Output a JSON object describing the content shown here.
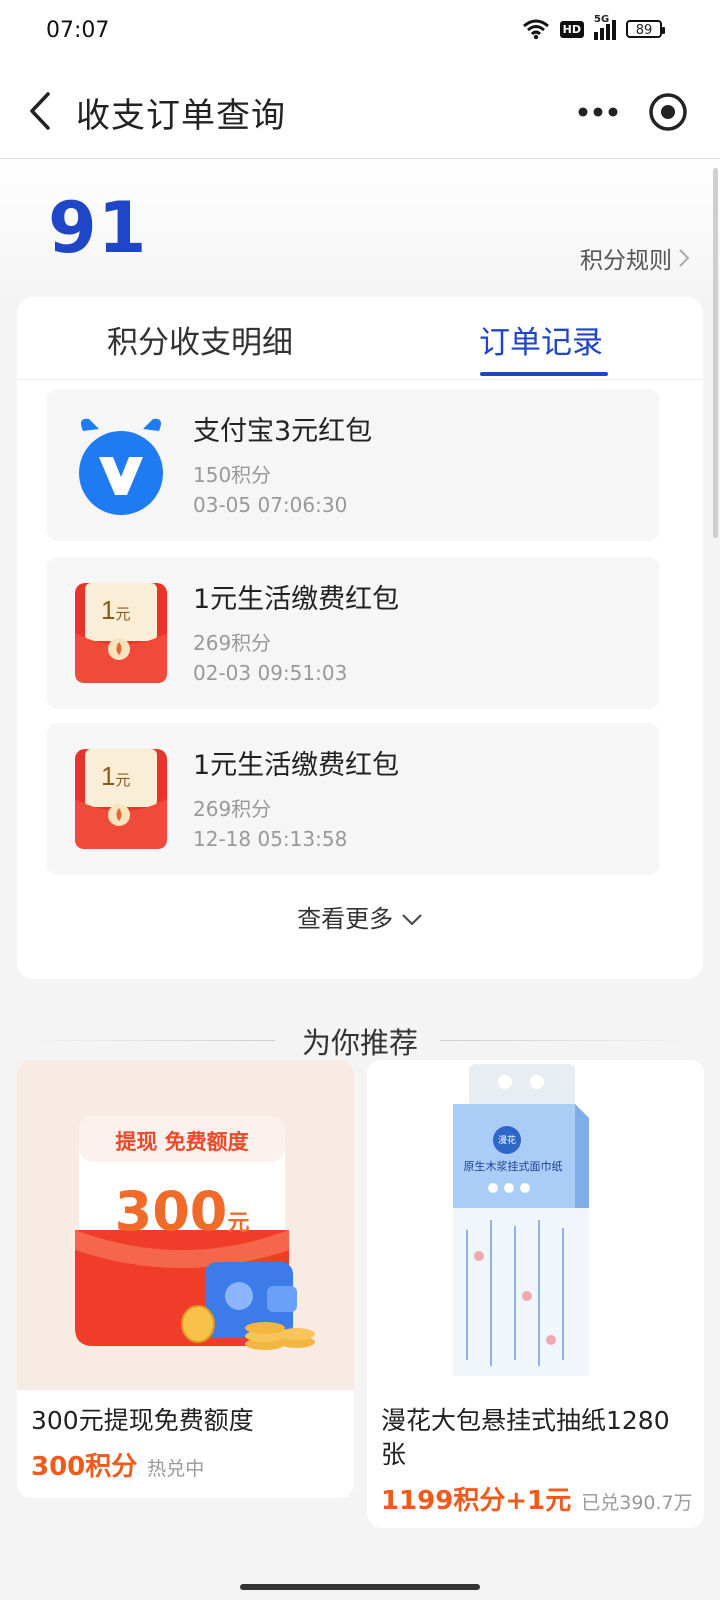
{
  "status": {
    "time": "07:07",
    "network": "5G",
    "hd": "HD",
    "battery": "89"
  },
  "nav": {
    "title": "收支订单查询"
  },
  "summary": {
    "points": "91",
    "rules_label": "积分规则"
  },
  "tabs": [
    {
      "label": "积分收支明细",
      "active": false
    },
    {
      "label": "订单记录",
      "active": true
    }
  ],
  "orders": [
    {
      "name": "支付宝3元红包",
      "points": "150积分",
      "date": "03-05 07:06:30",
      "icon": "alipay-v-icon"
    },
    {
      "name": "1元生活缴费红包",
      "points": "269积分",
      "date": "02-03 09:51:03",
      "icon": "red-envelope-icon",
      "badge": "1",
      "badge_unit": "元"
    },
    {
      "name": "1元生活缴费红包",
      "points": "269积分",
      "date": "12-18 05:13:58",
      "icon": "red-envelope-icon",
      "badge": "1",
      "badge_unit": "元"
    }
  ],
  "see_more": "查看更多",
  "recommend": {
    "title": "为你推荐",
    "products": [
      {
        "name": "300元提现免费额度",
        "price": "300积分",
        "note": "热兑中",
        "image_banner": "提现 免费额度",
        "image_amount": "300",
        "image_unit": "元"
      },
      {
        "name": "漫花大包悬挂式抽纸1280张",
        "price": "1199积分+1元",
        "note": "已兑390.7万",
        "image_brand": "漫花",
        "image_caption": "原生木浆挂式面巾纸"
      }
    ]
  },
  "colors": {
    "accent": "#1f46c7",
    "price": "#f05a1a",
    "red_envelope": "#e8352c"
  }
}
